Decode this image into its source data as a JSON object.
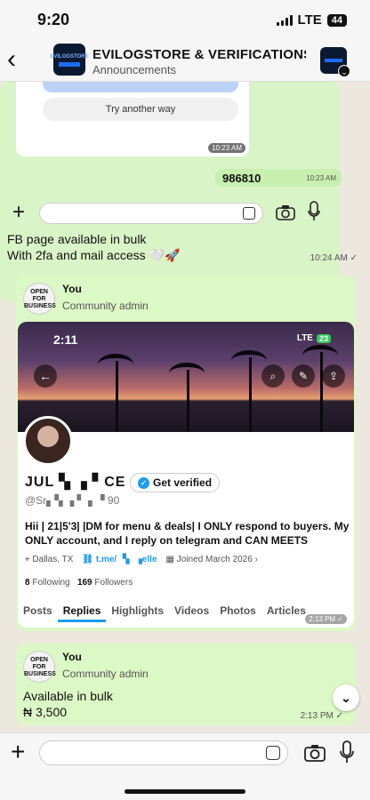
{
  "status": {
    "time": "9:20",
    "network": "LTE",
    "battery": "44"
  },
  "header": {
    "title": "EVILOGSTORE & VERIFICATIONS...",
    "subtitle": "Announcements",
    "avatar_text": "EVILOGSTORE",
    "avatar_sub": "verification"
  },
  "screenshot1": {
    "button_label": "Try another way",
    "timestamp": "10:23 AM",
    "code": "986810",
    "code_time": "10:23 AM"
  },
  "message1": {
    "line1": "FB page available in bulk",
    "line2": "With 2fa and mail access 🤍🚀",
    "time": "10:24 AM"
  },
  "message2": {
    "sender": "You",
    "role": "Community admin",
    "avatar_text": "OPEN FOR BUSINESS",
    "profile": {
      "time": "2:11",
      "network": "LTE",
      "battery": "23",
      "name": "JUL ▚ ▗ ▘CE",
      "verified_label": "Get verified",
      "handle": "@Sr▖▚ ▗ ▘ ▖▝ 90",
      "bio": "Hii | 21|5'3| |DM for menu & deals| I ONLY respond to buyers. My ONLY account, and I reply on telegram and CAN MEETS",
      "location": "Dallas, TX",
      "link": "t.me/ ▝▖ ▗elle",
      "joined": "Joined March 2026",
      "following_count": "8",
      "following_label": "Following",
      "followers_count": "169",
      "followers_label": "Followers",
      "tabs": [
        "Posts",
        "Replies",
        "Highlights",
        "Videos",
        "Photos",
        "Articles"
      ],
      "active_tab": "Replies"
    },
    "time": "2:13 PM"
  },
  "message3": {
    "sender": "You",
    "role": "Community admin",
    "line1": "Available in bulk",
    "line2": "₦ 3,500",
    "time": "2:13 PM"
  },
  "icons": [
    "back-icon",
    "camera-icon",
    "mic-icon",
    "sticker-icon",
    "plus-icon",
    "chevron-down-icon",
    "verified-icon"
  ]
}
